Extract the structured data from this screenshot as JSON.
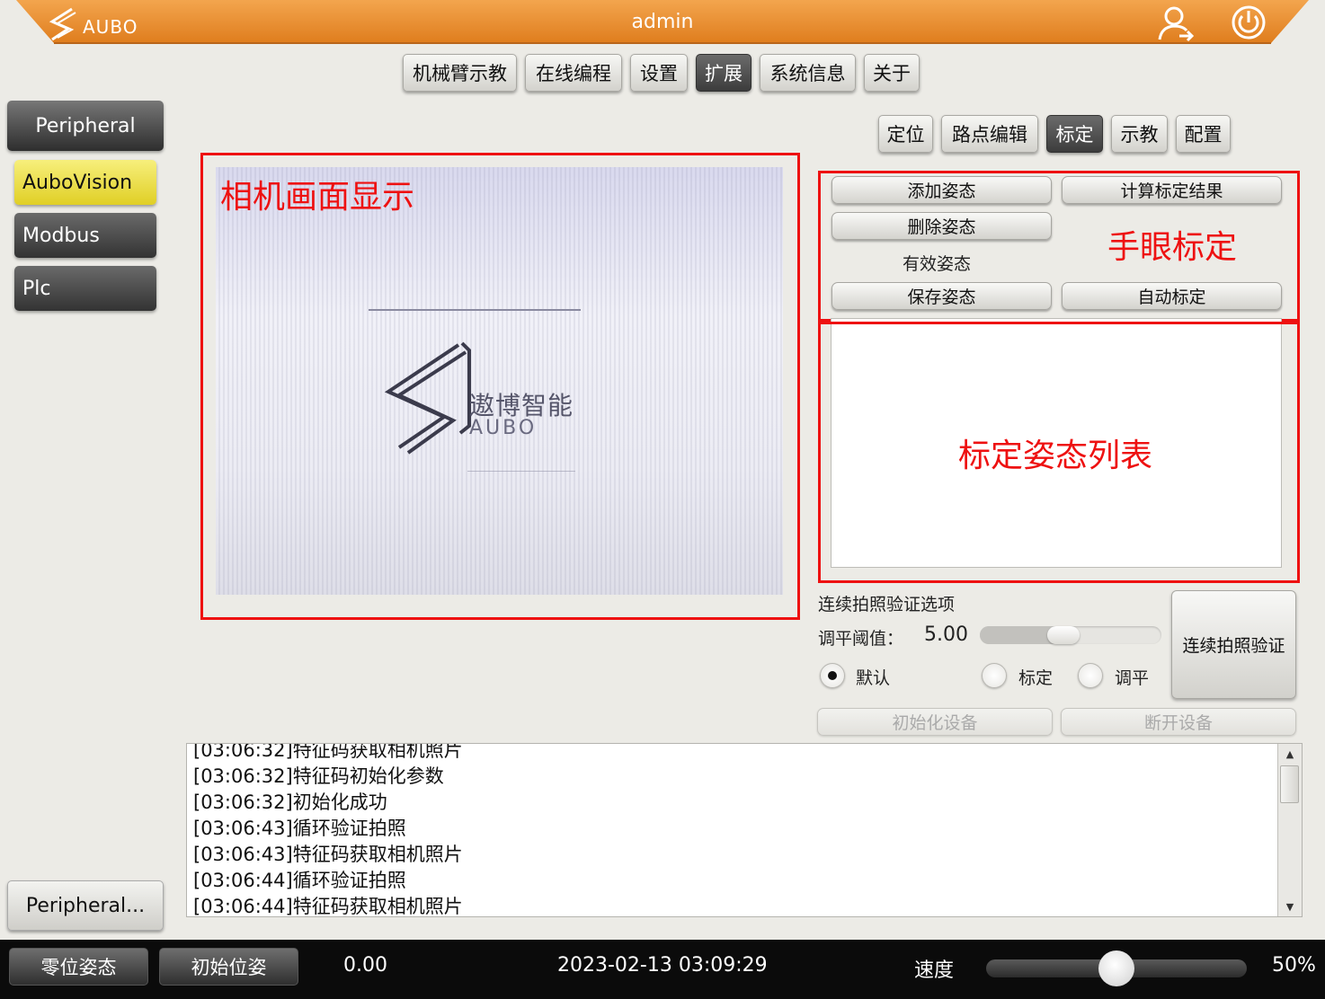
{
  "header": {
    "logo_text": "AUBO",
    "title": "admin"
  },
  "top_nav": {
    "tabs": [
      {
        "label": "机械臂示教"
      },
      {
        "label": "在线编程"
      },
      {
        "label": "设置"
      },
      {
        "label": "扩展",
        "active": true
      },
      {
        "label": "系统信息"
      },
      {
        "label": "关于"
      }
    ]
  },
  "sidebar": {
    "section_label": "Peripheral",
    "items": [
      {
        "label": "AuboVision",
        "active": true
      },
      {
        "label": "Modbus"
      },
      {
        "label": "Plc"
      }
    ],
    "bottom_label": "Peripheral..."
  },
  "sub_tabs": [
    {
      "label": "定位"
    },
    {
      "label": "路点编辑"
    },
    {
      "label": "标定",
      "active": true
    },
    {
      "label": "示教"
    },
    {
      "label": "配置"
    }
  ],
  "camera": {
    "annotation": "相机画面显示",
    "logo_cn": "遨博智能",
    "logo_en": "AUBO"
  },
  "calibration": {
    "annotation": "手眼标定",
    "add_pose": "添加姿态",
    "compute_result": "计算标定结果",
    "delete_pose": "删除姿态",
    "valid_pose": "有效姿态",
    "save_pose": "保存姿态",
    "auto_calibrate": "自动标定",
    "list_annotation": "标定姿态列表"
  },
  "verify": {
    "options_title": "连续拍照验证选项",
    "threshold_label": "调平阈值：",
    "threshold_value": "5.00",
    "threshold_fraction": 0.45,
    "radio_default": "默认",
    "radio_calibrate": "标定",
    "radio_level": "调平",
    "selected": "默认",
    "continuous_button": "连续拍照验证",
    "init_device": "初始化设备",
    "disconnect_device": "断开设备"
  },
  "log": {
    "lines": [
      "[03:06:32]特征码获取相机照片",
      "[03:06:32]特征码初始化参数",
      "[03:06:32]初始化成功",
      "[03:06:43]循环验证拍照",
      "[03:06:43]特征码获取相机照片",
      "[03:06:44]循环验证拍照",
      "[03:06:44]特征码获取相机照片"
    ]
  },
  "status_bar": {
    "zero_pose": "零位姿态",
    "init_pose": "初始位姿",
    "value": "0.00",
    "datetime": "2023-02-13 03:09:29",
    "speed_label": "速度",
    "speed_value": "50%",
    "speed_fraction": 0.5
  },
  "colors": {
    "header_orange": "#e8892a",
    "annotation_red": "#ee1111",
    "active_yellow": "#e6d630"
  }
}
